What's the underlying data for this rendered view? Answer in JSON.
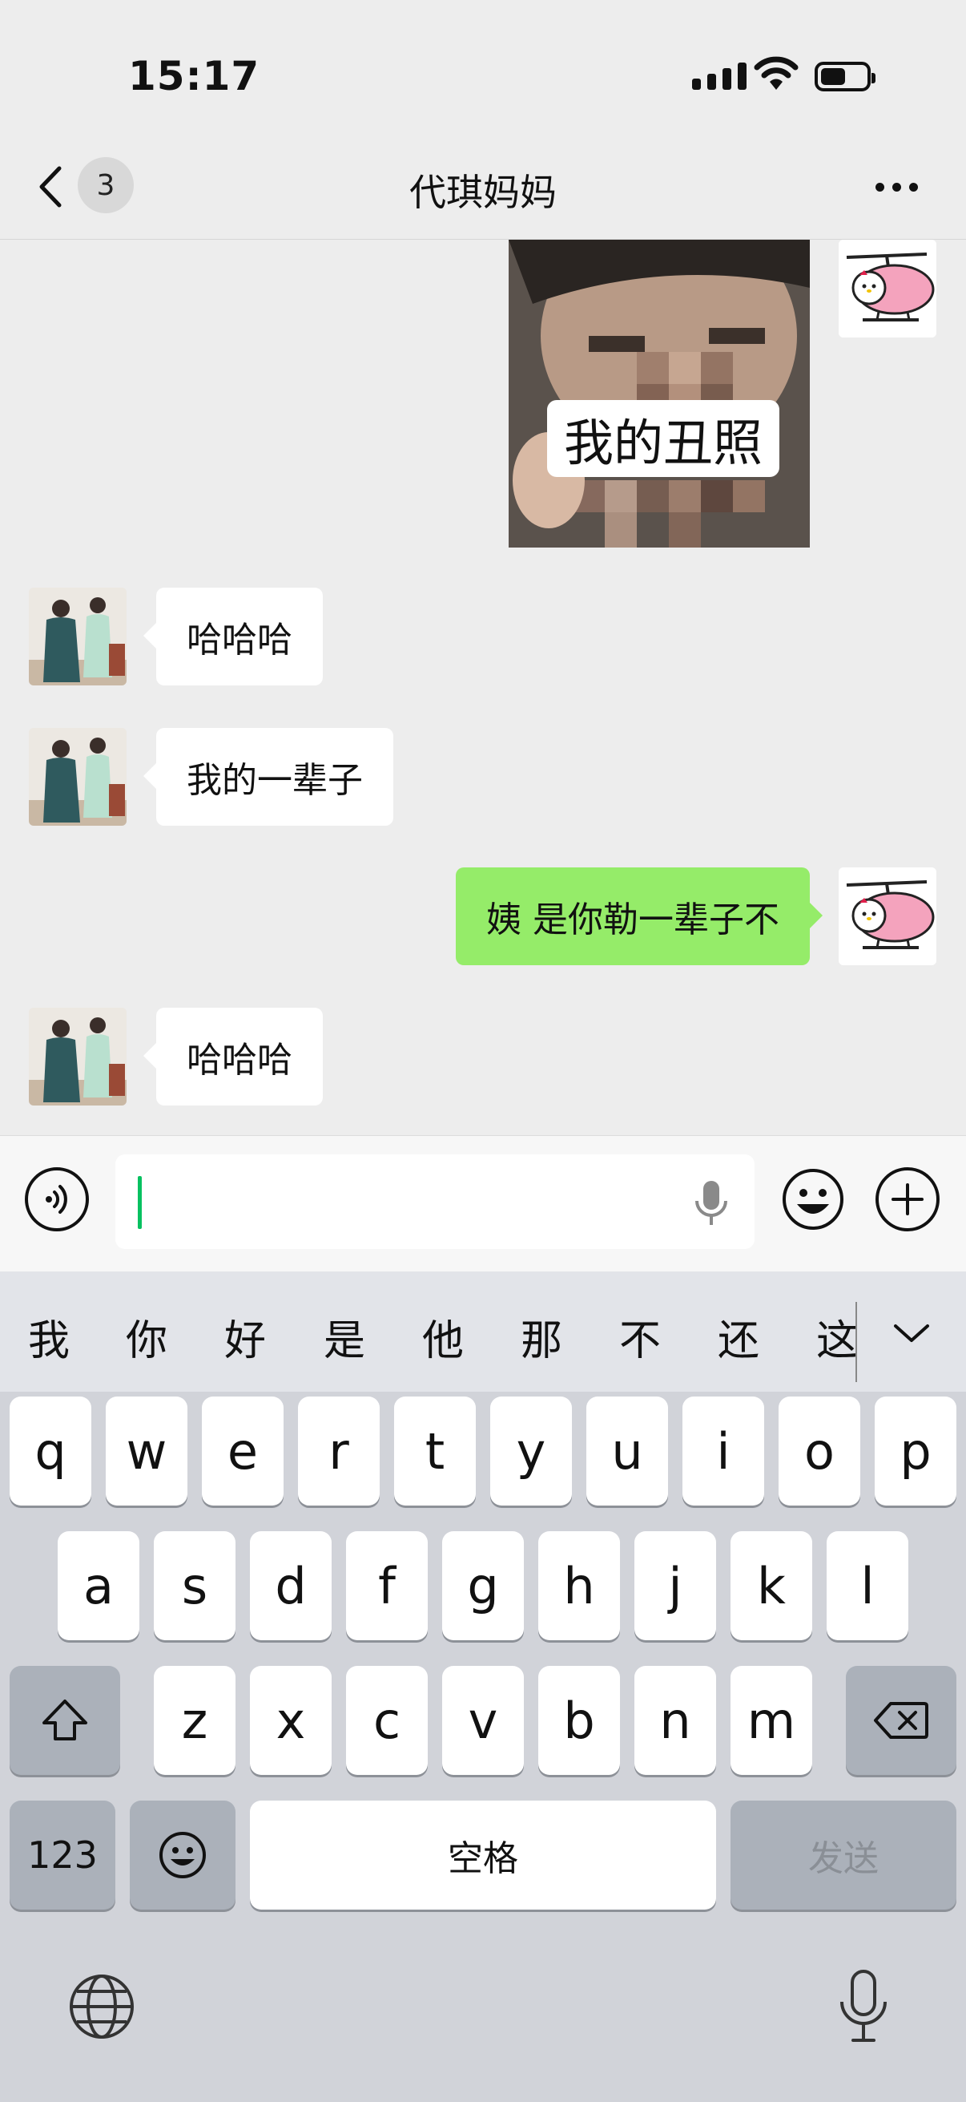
{
  "status_bar": {
    "time": "15:17"
  },
  "header": {
    "unread_count": "3",
    "title": "代琪妈妈"
  },
  "messages": [
    {
      "side": "right",
      "type": "image",
      "caption": "我的丑照"
    },
    {
      "side": "left",
      "type": "text",
      "text": "哈哈哈"
    },
    {
      "side": "left",
      "type": "text",
      "text": "我的一辈子"
    },
    {
      "side": "right",
      "type": "text",
      "text": "姨 是你勒一辈子不"
    },
    {
      "side": "left",
      "type": "text",
      "text": "哈哈哈"
    }
  ],
  "input": {
    "value": ""
  },
  "keyboard": {
    "candidates": [
      "我",
      "你",
      "好",
      "是",
      "他",
      "那",
      "不",
      "还",
      "这"
    ],
    "row1": [
      "q",
      "w",
      "e",
      "r",
      "t",
      "y",
      "u",
      "i",
      "o",
      "p"
    ],
    "row2": [
      "a",
      "s",
      "d",
      "f",
      "g",
      "h",
      "j",
      "k",
      "l"
    ],
    "row3": [
      "z",
      "x",
      "c",
      "v",
      "b",
      "n",
      "m"
    ],
    "numbers_label": "123",
    "space_label": "空格",
    "send_label": "发送"
  },
  "colors": {
    "sent_bubble": "#95ec69",
    "received_bubble": "#ffffff",
    "background": "#ededed",
    "cursor": "#07c160"
  },
  "icons": [
    "back-chevron-icon",
    "more-dots-icon",
    "voice-icon",
    "mic-icon",
    "emoji-icon",
    "plus-icon",
    "shift-icon",
    "backspace-icon",
    "globe-icon"
  ]
}
